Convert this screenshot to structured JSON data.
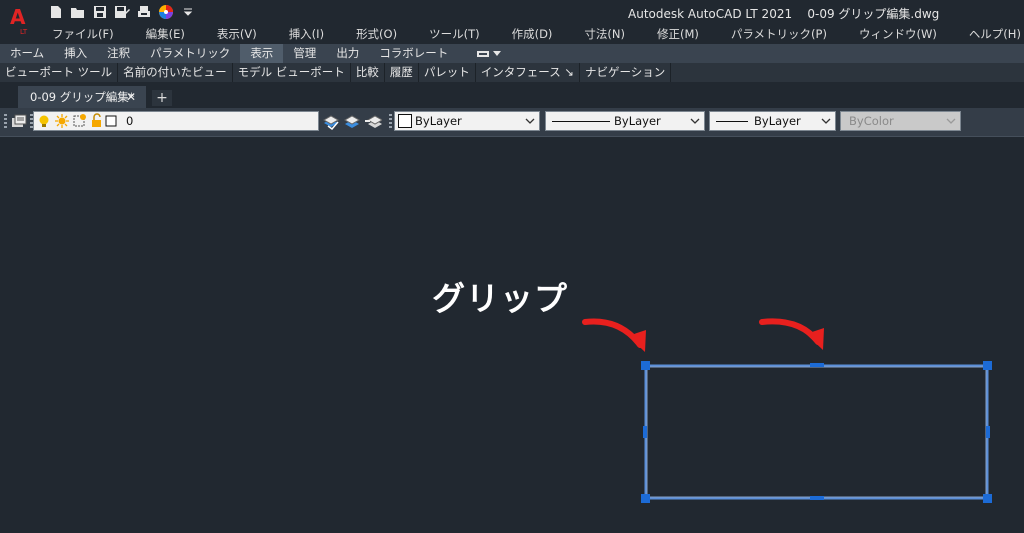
{
  "app": {
    "logo_letter": "A",
    "logo_badge": "LT",
    "title": "Autodesk AutoCAD LT 2021",
    "filename": "0-09 グリップ編集.dwg"
  },
  "quick_access": [
    "new-icon",
    "open-icon",
    "save-icon",
    "saveas-icon",
    "plot-icon",
    "color-wheel-icon",
    "dropdown-icon"
  ],
  "menubar": [
    "ファイル(F)",
    "編集(E)",
    "表示(V)",
    "挿入(I)",
    "形式(O)",
    "ツール(T)",
    "作成(D)",
    "寸法(N)",
    "修正(M)",
    "パラメトリック(P)",
    "ウィンドウ(W)",
    "ヘルプ(H)"
  ],
  "ribbon_tabs": [
    "ホーム",
    "挿入",
    "注釈",
    "パラメトリック",
    "表示",
    "管理",
    "出力",
    "コラボレート"
  ],
  "ribbon_active": "表示",
  "ribbon_panels": [
    "ビューポート ツール",
    "名前の付いたビュー",
    "モデル ビューポート",
    "比較",
    "履歴",
    "パレット",
    "インタフェース ↘",
    "ナビゲーション"
  ],
  "document_tab": {
    "label": "0-09 グリップ編集*",
    "close": "✕",
    "add": "+"
  },
  "layer_toolbar": {
    "layer_value": "0",
    "color_value": "ByLayer",
    "linetype_value": "ByLayer",
    "lineweight_value": "ByLayer",
    "plotstyle_value": "ByColor"
  },
  "annotation": {
    "label": "グリップ",
    "arrow_color": "#e8201e"
  },
  "colors": {
    "background": "#212830",
    "selection": "#5b8fd9",
    "grip": "#1c6bd6"
  }
}
